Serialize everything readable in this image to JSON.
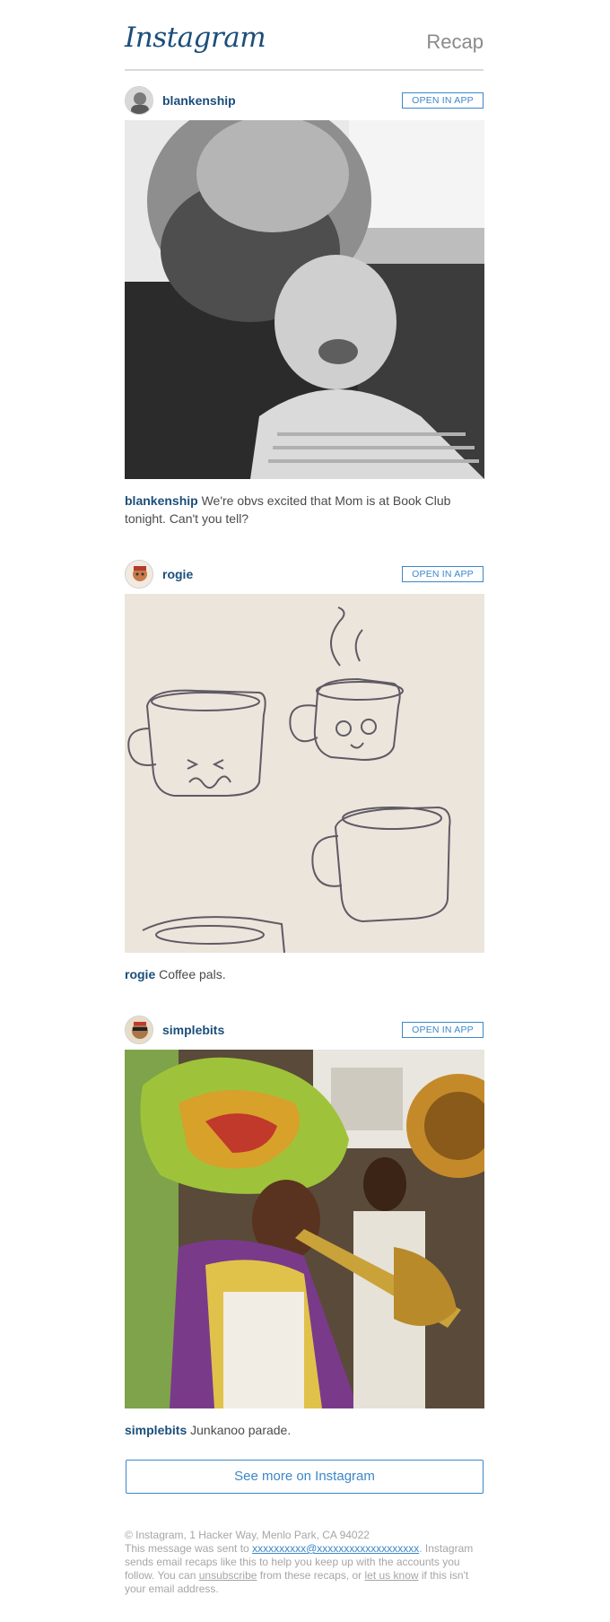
{
  "header": {
    "logo_text": "Instagram",
    "recap_label": "Recap"
  },
  "posts": [
    {
      "username": "blankenship",
      "open_in_app_label": "OPEN IN APP",
      "caption_user": "blankenship",
      "caption_text": " We're obvs excited that Mom is at Book Club tonight. Can't you tell?",
      "photo_description_icon": "photo-father-baby"
    },
    {
      "username": "rogie",
      "open_in_app_label": "OPEN IN APP",
      "caption_user": "rogie",
      "caption_text": " Coffee pals.",
      "photo_description_icon": "photo-coffee-sketch"
    },
    {
      "username": "simplebits",
      "open_in_app_label": "OPEN IN APP",
      "caption_user": "simplebits",
      "caption_text": " Junkanoo parade.",
      "photo_description_icon": "photo-junkanoo-parade"
    }
  ],
  "see_more_label": "See more on Instagram",
  "footer": {
    "address": "© Instagram, 1 Hacker Way, Menlo Park, CA 94022",
    "sent_prefix": "This message was sent to ",
    "email": "xxxxxxxxxx@xxxxxxxxxxxxxxxxxxx",
    "sent_suffix": ". Instagram sends email recaps like this to help you keep up with the accounts you follow. You can ",
    "unsubscribe_label": "unsubscribe",
    "middle_text": " from these recaps, or ",
    "let_us_know_label": "let us know",
    "end_text": " if this isn't your email address."
  },
  "colors": {
    "brand_blue": "#1b4e7a",
    "link_blue": "#3d87c9",
    "muted_gray": "#a6a6a6"
  }
}
